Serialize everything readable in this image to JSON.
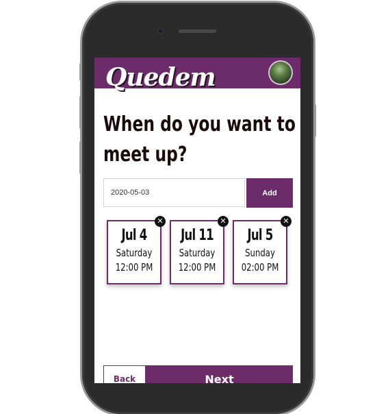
{
  "app": {
    "logo_text": "Quedem"
  },
  "page": {
    "title_line1": "When do you want to",
    "title_line2": "meet up?"
  },
  "date_entry": {
    "value": "2020-05-03",
    "add_label": "Add"
  },
  "dates": [
    {
      "date": "Jul 4",
      "weekday": "Saturday",
      "time": "12:00 PM"
    },
    {
      "date": "Jul 11",
      "weekday": "Saturday",
      "time": "12:00 PM"
    },
    {
      "date": "Jul 5",
      "weekday": "Sunday",
      "time": "02:00 PM"
    }
  ],
  "nav": {
    "back_label": "Back",
    "next_label": "Next"
  },
  "icons": {
    "remove": "close-circle-icon",
    "avatar": "user-avatar"
  },
  "colors": {
    "brand": "#6b2c69",
    "text": "#1a0a0a"
  }
}
